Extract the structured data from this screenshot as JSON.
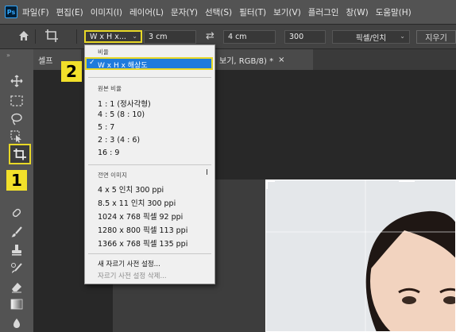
{
  "menubar": {
    "logo": "Ps",
    "items": [
      "파일(F)",
      "편집(E)",
      "이미지(I)",
      "레이어(L)",
      "문자(Y)",
      "선택(S)",
      "필터(T)",
      "보기(V)",
      "플러그인",
      "창(W)",
      "도움말(H)"
    ]
  },
  "options": {
    "ratio_value": "W x H x...",
    "width_value": "3 cm",
    "height_value": "4 cm",
    "resolution_value": "300",
    "unit_value": "픽셀/인치",
    "clear_label": "지우기"
  },
  "tabs": {
    "tab1": "셀프",
    "tab2": "보기, RGB/8) *",
    "tab2_close": "×"
  },
  "dropdown": {
    "section_ratio": "비율",
    "selected": "W x H x 해상도",
    "section_original": "원본 비율",
    "items_ratio": [
      "1 : 1 (정사각형)",
      "4 : 5 (8 : 10)",
      "5 : 7",
      "2 : 3 (4 : 6)",
      "16 : 9"
    ],
    "section_presets": "전면 이미지",
    "items_presets": [
      "4 x 5 인치 300 ppi",
      "8.5 x 11 인치 300 ppi",
      "1024 x 768 픽셀 92 ppi",
      "1280 x 800 픽셀 113 ppi",
      "1366 x 768 픽셀 135 ppi"
    ],
    "new_preset": "새 자르기 사전 설정...",
    "delete_preset": "자르기 사전 설정 삭제..."
  },
  "badges": {
    "one": "1",
    "two": "2"
  },
  "colors": {
    "highlight": "#e8d827",
    "selection": "#1e7bdc"
  }
}
